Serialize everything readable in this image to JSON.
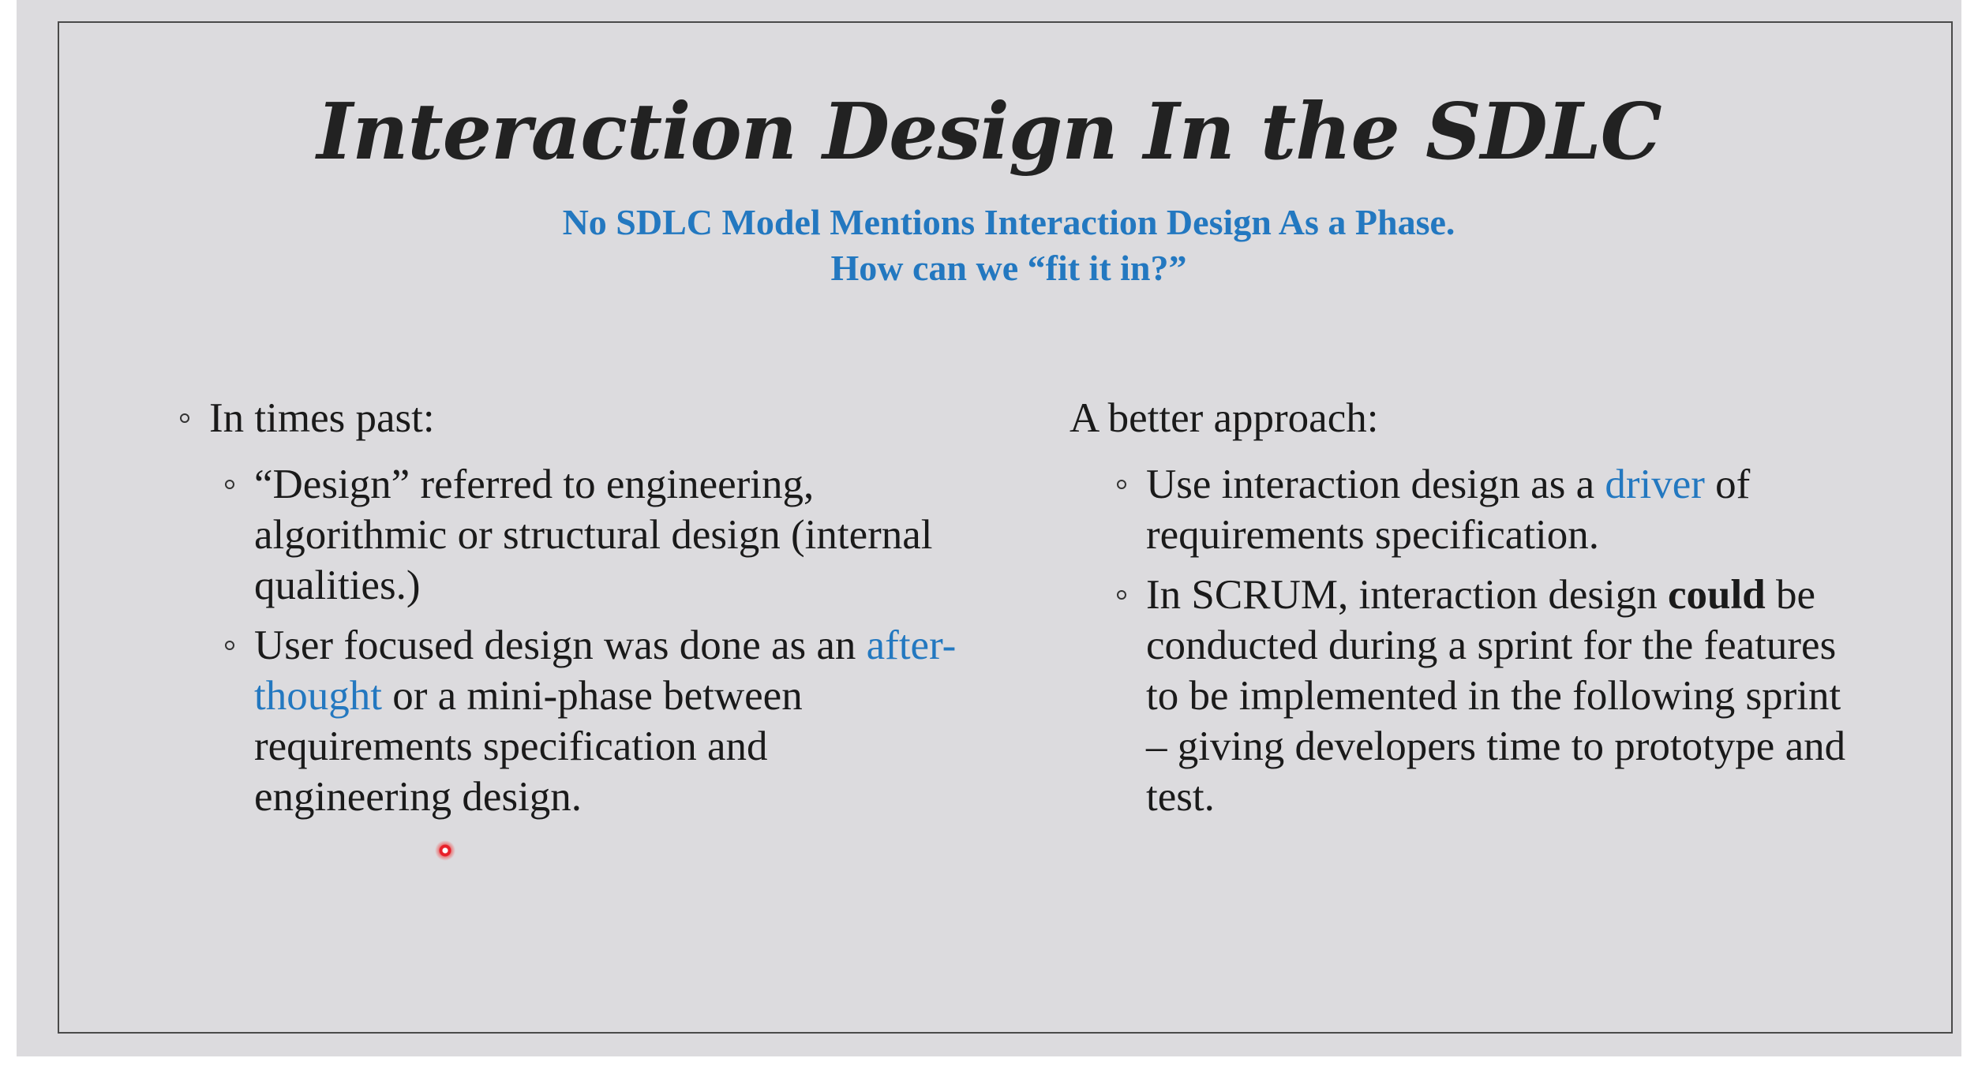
{
  "slide": {
    "title": "Interaction Design In the SDLC",
    "subtitle_line1": "No SDLC Model Mentions Interaction Design As a Phase.",
    "subtitle_line2": "How can we “fit it in?”",
    "left": {
      "heading": "In times past:",
      "item1": "“Design” referred to engineering, algorithmic or structural design (internal qualities.)",
      "item2_pre": "User focused design was done as an ",
      "item2_accent": "after-thought",
      "item2_post": " or a mini-phase between requirements specification and engineering design."
    },
    "right": {
      "heading": "A better approach:",
      "item1_pre": "Use interaction design as a ",
      "item1_accent": "driver",
      "item1_post": " of requirements specification.",
      "item2_pre": "In SCRUM, interaction design ",
      "item2_bold": "could",
      "item2_post": " be conducted during a sprint for the features to be implemented in the following sprint – giving developers time to prototype and test."
    },
    "colors": {
      "accent": "#2378c0",
      "text": "#1a1a1a",
      "background": "#dcdbde",
      "laser": "#e8202a"
    }
  }
}
